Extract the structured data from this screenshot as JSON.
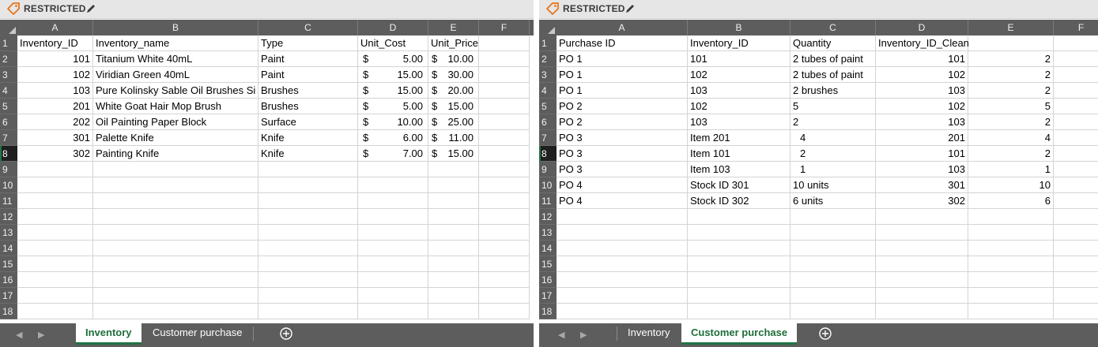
{
  "windows": [
    {
      "restricted_label": "RESTRICTED",
      "columns": [
        "A",
        "B",
        "C",
        "D",
        "E",
        "F"
      ],
      "row_numbers": [
        "1",
        "2",
        "3",
        "4",
        "5",
        "6",
        "7",
        "8",
        "9",
        "10",
        "11",
        "12",
        "13",
        "14",
        "15",
        "16",
        "17",
        "18"
      ],
      "selected_row": "8",
      "headers": [
        "Inventory_ID",
        "Inventory_name",
        "Type",
        "Unit_Cost",
        "Unit_Price"
      ],
      "rows": [
        {
          "id": "101",
          "name": "Titanium White 40mL",
          "type": "Paint",
          "cost_sign": "$",
          "cost": "5.00",
          "price_sign": "$",
          "price": "10.00"
        },
        {
          "id": "102",
          "name": "Viridian Green 40mL",
          "type": "Paint",
          "cost_sign": "$",
          "cost": "15.00",
          "price_sign": "$",
          "price": "30.00"
        },
        {
          "id": "103",
          "name": "Pure Kolinsky Sable Oil Brushes Si",
          "type": "Brushes",
          "cost_sign": "$",
          "cost": "15.00",
          "price_sign": "$",
          "price": "20.00"
        },
        {
          "id": "201",
          "name": "White Goat Hair Mop Brush",
          "type": "Brushes",
          "cost_sign": "$",
          "cost": "5.00",
          "price_sign": "$",
          "price": "15.00"
        },
        {
          "id": "202",
          "name": "Oil Painting Paper Block",
          "type": "Surface",
          "cost_sign": "$",
          "cost": "10.00",
          "price_sign": "$",
          "price": "25.00"
        },
        {
          "id": "301",
          "name": "Palette Knife",
          "type": "Knife",
          "cost_sign": "$",
          "cost": "6.00",
          "price_sign": "$",
          "price": "11.00"
        },
        {
          "id": "302",
          "name": "Painting Knife",
          "type": "Knife",
          "cost_sign": "$",
          "cost": "7.00",
          "price_sign": "$",
          "price": "15.00"
        }
      ],
      "tabs": [
        "Inventory",
        "Customer purchase"
      ],
      "active_tab": 0
    },
    {
      "restricted_label": "RESTRICTED",
      "columns": [
        "A",
        "B",
        "C",
        "D",
        "E",
        "F"
      ],
      "row_numbers": [
        "1",
        "2",
        "3",
        "4",
        "5",
        "6",
        "7",
        "8",
        "9",
        "10",
        "11",
        "12",
        "13",
        "14",
        "15",
        "16",
        "17",
        "18"
      ],
      "selected_row": "8",
      "headers": [
        "Purchase ID",
        "Inventory_ID",
        "Quantity",
        "Inventory_ID_Clean",
        ""
      ],
      "rows": [
        {
          "purchase": "PO 1",
          "inv": "101",
          "qty": "2 tubes of paint",
          "clean": "101",
          "e": "2"
        },
        {
          "purchase": "PO 1",
          "inv": "102",
          "qty": "2 tubes of paint",
          "clean": "102",
          "e": "2"
        },
        {
          "purchase": "PO 1",
          "inv": "103",
          "qty": "2 brushes",
          "clean": "103",
          "e": "2"
        },
        {
          "purchase": "PO 2",
          "inv": "102",
          "qty": "5",
          "clean": "102",
          "e": "5"
        },
        {
          "purchase": "PO 2",
          "inv": "103",
          "qty": "2",
          "clean": "103",
          "e": "2"
        },
        {
          "purchase": "PO 3",
          "inv": "Item 201",
          "qty": "4",
          "clean": "201",
          "e": "4"
        },
        {
          "purchase": "PO 3",
          "inv": "Item 101",
          "qty": "2",
          "clean": "101",
          "e": "2"
        },
        {
          "purchase": "PO 3",
          "inv": "Item 103",
          "qty": "1",
          "clean": "103",
          "e": "1"
        },
        {
          "purchase": "PO 4",
          "inv": "Stock ID 301",
          "qty": "10 units",
          "clean": "301",
          "e": "10"
        },
        {
          "purchase": "PO 4",
          "inv": "Stock ID 302",
          "qty": "6 units",
          "clean": "302",
          "e": "6"
        }
      ],
      "tabs": [
        "Inventory",
        "Customer purchase"
      ],
      "active_tab": 1
    }
  ],
  "colors": {
    "accent_green": "#217346",
    "header_gray": "#5d5d5d",
    "restricted_bar": "#e6e6e6",
    "tag_orange": "#e8741a"
  },
  "icons": [
    "tag-icon",
    "pencil-icon",
    "select-all-icon",
    "nav-left-icon",
    "nav-right-icon",
    "add-sheet-icon"
  ]
}
